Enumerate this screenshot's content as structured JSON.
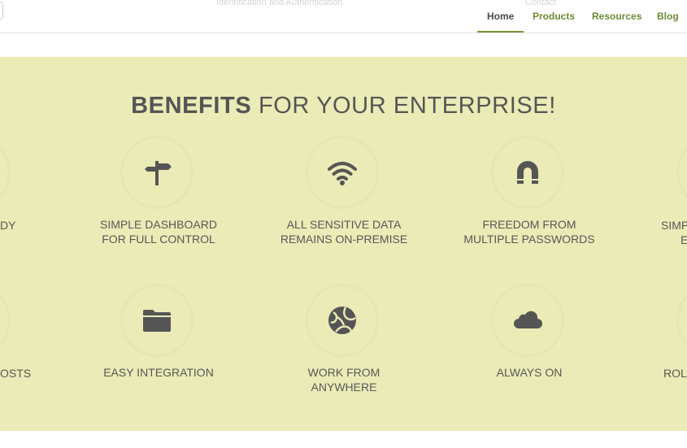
{
  "header": {
    "faint_text_1": "Identification and Authentication",
    "faint_text_2": "Contact",
    "nav": [
      {
        "label": "Home",
        "active": true
      },
      {
        "label": "Products",
        "active": false
      },
      {
        "label": "Resources",
        "active": false
      },
      {
        "label": "Blog",
        "active": false
      }
    ]
  },
  "benefits": {
    "title_bold": "BENEFITS",
    "title_rest": " FOR YOUR ENTERPRISE!",
    "row1": [
      {
        "icon": "signpost-icon",
        "line1": "SIMPLE DASHBOARD",
        "line2": "FOR FULL CONTROL"
      },
      {
        "icon": "wifi-icon",
        "line1": "ALL SENSITIVE DATA",
        "line2": "REMAINS ON-PREMISE"
      },
      {
        "icon": "magnet-icon",
        "line1": "FREEDOM FROM",
        "line2": "MULTIPLE PASSWORDS"
      }
    ],
    "row2": [
      {
        "icon": "folder-icon",
        "line1": "EASY INTEGRATION",
        "line2": ""
      },
      {
        "icon": "globe-icon",
        "line1": "WORK FROM",
        "line2": "ANYWHERE"
      },
      {
        "icon": "cloud-icon",
        "line1": "ALWAYS ON",
        "line2": ""
      }
    ],
    "edge_left_row1": "DY",
    "edge_left_row2": "OSTS",
    "edge_right_row1_line1": "SIMP",
    "edge_right_row1_line2": "E",
    "edge_right_row2": "ROL"
  },
  "colors": {
    "band_background": "#ebebb7",
    "nav_link": "#6f8a34",
    "nav_active": "#4a4a4a",
    "icon": "#555555",
    "text": "#575757"
  }
}
